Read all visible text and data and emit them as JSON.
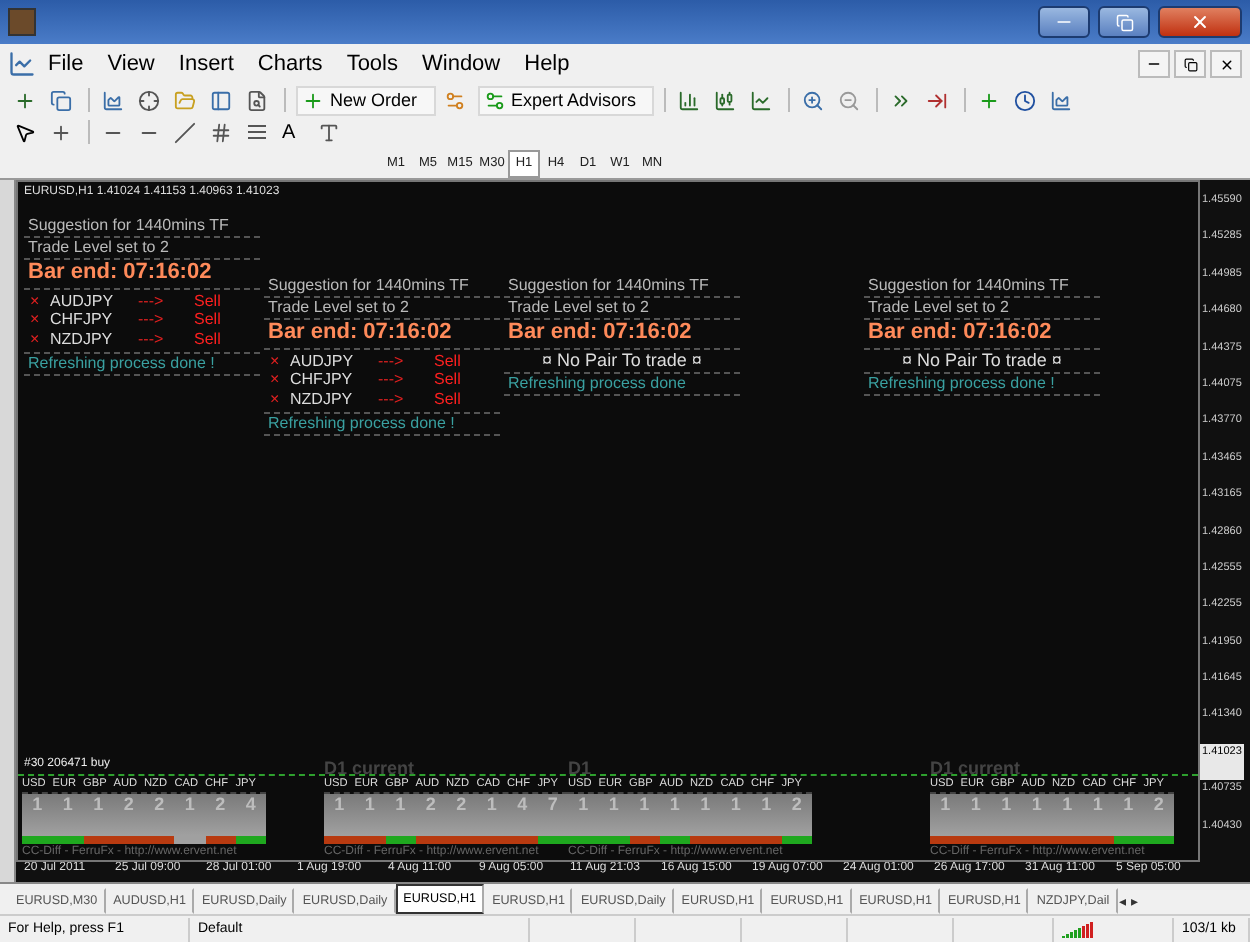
{
  "menu": [
    {
      "label": "File"
    },
    {
      "label": "View"
    },
    {
      "label": "Insert"
    },
    {
      "label": "Charts"
    },
    {
      "label": "Tools"
    },
    {
      "label": "Window"
    },
    {
      "label": "Help"
    }
  ],
  "toolbar": {
    "new_order": "New Order",
    "expert_advisors": "Expert Advisors",
    "text_tool": "A"
  },
  "timeframes": [
    {
      "label": "M1",
      "selected": false
    },
    {
      "label": "M5",
      "selected": false
    },
    {
      "label": "M15",
      "selected": false
    },
    {
      "label": "M30",
      "selected": false
    },
    {
      "label": "H1",
      "selected": true
    },
    {
      "label": "H4",
      "selected": false
    },
    {
      "label": "D1",
      "selected": false
    },
    {
      "label": "W1",
      "selected": false
    },
    {
      "label": "MN",
      "selected": false
    }
  ],
  "chart": {
    "header": "EURUSD,H1  1.41024 1.41153 1.40963 1.41023",
    "panels": [
      {
        "kind": "signals",
        "heading": "Suggestion for 1440mins TF",
        "level": "Trade Level set to 2",
        "bar_end": "Bar end: 07:16:02",
        "signals": [
          {
            "mark": "×",
            "pair": "AUDJPY",
            "arrow": "--->",
            "action": "Sell"
          },
          {
            "mark": "×",
            "pair": "CHFJPY",
            "arrow": "--->",
            "action": "Sell"
          },
          {
            "mark": "×",
            "pair": "NZDJPY",
            "arrow": "--->",
            "action": "Sell"
          }
        ],
        "footer": "Refreshing process done !"
      },
      {
        "kind": "signals",
        "heading": "Suggestion for 1440mins TF",
        "level": "Trade Level set to 2",
        "bar_end": "Bar end: 07:16:02",
        "signals": [
          {
            "mark": "×",
            "pair": "AUDJPY",
            "arrow": "--->",
            "action": "Sell"
          },
          {
            "mark": "×",
            "pair": "CHFJPY",
            "arrow": "--->",
            "action": "Sell"
          },
          {
            "mark": "×",
            "pair": "NZDJPY",
            "arrow": "--->",
            "action": "Sell"
          }
        ],
        "footer": "Refreshing process done !"
      },
      {
        "kind": "no_pair",
        "heading": "Suggestion for 1440mins TF",
        "level": "Trade Level set to 2",
        "bar_end": "Bar end: 07:16:02",
        "message": "¤ No Pair To trade ¤",
        "footer": "Refreshing process done"
      },
      {
        "kind": "no_pair",
        "heading": "Suggestion for 1440mins TF",
        "level": "Trade Level set to 2",
        "bar_end": "Bar end: 07:16:02",
        "message": "¤ No Pair To trade ¤",
        "footer": "Refreshing process done !"
      }
    ],
    "order_label": "#30 206471 buy",
    "strips": [
      {
        "currencies": [
          {
            "code": "USD",
            "value": "1",
            "color": "#1fa81f"
          },
          {
            "code": "EUR",
            "value": "1",
            "color": "#1fa81f"
          },
          {
            "code": "GBP",
            "value": "1",
            "color": "#b83a10"
          },
          {
            "code": "AUD",
            "value": "2",
            "color": "#b83a10"
          },
          {
            "code": "NZD",
            "value": "2",
            "color": "#b83a10"
          },
          {
            "code": "CAD",
            "value": "1",
            "color": "#a0a0a0"
          },
          {
            "code": "CHF",
            "value": "2",
            "color": "#b83a10"
          },
          {
            "code": "JPY",
            "value": "4",
            "color": "#1fa81f"
          }
        ],
        "footer": "CC-Diff - FerruFx - http://www.ervent.net"
      },
      {
        "title": "D1  current",
        "currencies": [
          {
            "code": "USD",
            "value": "1",
            "color": "#b83a10"
          },
          {
            "code": "EUR",
            "value": "1",
            "color": "#b83a10"
          },
          {
            "code": "GBP",
            "value": "1",
            "color": "#1fa81f"
          },
          {
            "code": "AUD",
            "value": "2",
            "color": "#b83a10"
          },
          {
            "code": "NZD",
            "value": "2",
            "color": "#b83a10"
          },
          {
            "code": "CAD",
            "value": "1",
            "color": "#b83a10"
          },
          {
            "code": "CHF",
            "value": "4",
            "color": "#b83a10"
          },
          {
            "code": "JPY",
            "value": "7",
            "color": "#1fa81f"
          }
        ],
        "footer": "CC-Diff - FerruFx - http://www.ervent.net"
      },
      {
        "title": "D1",
        "currencies": [
          {
            "code": "USD",
            "value": "1",
            "color": "#1fa81f"
          },
          {
            "code": "EUR",
            "value": "1",
            "color": "#1fa81f"
          },
          {
            "code": "GBP",
            "value": "1",
            "color": "#b83a10"
          },
          {
            "code": "AUD",
            "value": "1",
            "color": "#1fa81f"
          },
          {
            "code": "NZD",
            "value": "1",
            "color": "#b83a10"
          },
          {
            "code": "CAD",
            "value": "1",
            "color": "#b83a10"
          },
          {
            "code": "CHF",
            "value": "1",
            "color": "#b83a10"
          },
          {
            "code": "JPY",
            "value": "2",
            "color": "#1fa81f"
          }
        ],
        "footer": "CC-Diff - FerruFx - http://www.ervent.net"
      },
      {
        "title": "D1 current",
        "currencies": [
          {
            "code": "USD",
            "value": "1",
            "color": "#b83a10"
          },
          {
            "code": "EUR",
            "value": "1",
            "color": "#b83a10"
          },
          {
            "code": "GBP",
            "value": "1",
            "color": "#b83a10"
          },
          {
            "code": "AUD",
            "value": "1",
            "color": "#b83a10"
          },
          {
            "code": "NZD",
            "value": "1",
            "color": "#b83a10"
          },
          {
            "code": "CAD",
            "value": "1",
            "color": "#b83a10"
          },
          {
            "code": "CHF",
            "value": "1",
            "color": "#1fa81f"
          },
          {
            "code": "JPY",
            "value": "2",
            "color": "#1fa81f"
          }
        ],
        "footer": "CC-Diff - FerruFx - http://www.ervent.net"
      }
    ],
    "price_axis": [
      {
        "label": "1.45590",
        "current": false
      },
      {
        "label": "1.45285",
        "current": false
      },
      {
        "label": "1.44985",
        "current": false
      },
      {
        "label": "1.44680",
        "current": false
      },
      {
        "label": "1.44375",
        "current": false
      },
      {
        "label": "1.44075",
        "current": false
      },
      {
        "label": "1.43770",
        "current": false
      },
      {
        "label": "1.43465",
        "current": false
      },
      {
        "label": "1.43165",
        "current": false
      },
      {
        "label": "1.42860",
        "current": false
      },
      {
        "label": "1.42555",
        "current": false
      },
      {
        "label": "1.42255",
        "current": false
      },
      {
        "label": "1.41950",
        "current": false
      },
      {
        "label": "1.41645",
        "current": false
      },
      {
        "label": "1.41340",
        "current": false
      },
      {
        "label": "1.41023",
        "current": true
      },
      {
        "label": "1.40735",
        "current": false
      },
      {
        "label": "1.40430",
        "current": false
      }
    ],
    "time_axis": [
      "20 Jul 2011",
      "25 Jul 09:00",
      "28 Jul 01:00",
      "1 Aug 19:00",
      "4 Aug 11:00",
      "9 Aug 05:00",
      "11 Aug 21:03",
      "16 Aug 15:00",
      "19 Aug 07:00",
      "24 Aug 01:00",
      "26 Aug 17:00",
      "31 Aug 11:00",
      "5 Sep 05:00"
    ]
  },
  "tabs": [
    {
      "label": "EURUSD,M30",
      "selected": false
    },
    {
      "label": "AUDUSD,H1",
      "selected": false
    },
    {
      "label": "EURUSD,Daily",
      "selected": false
    },
    {
      "label": "EURUSD,Daily",
      "selected": false
    },
    {
      "label": "EURUSD,H1",
      "selected": true
    },
    {
      "label": "EURUSD,H1",
      "selected": false
    },
    {
      "label": "EURUSD,Daily",
      "selected": false
    },
    {
      "label": "EURUSD,H1",
      "selected": false
    },
    {
      "label": "EURUSD,H1",
      "selected": false
    },
    {
      "label": "EURUSD,H1",
      "selected": false
    },
    {
      "label": "EURUSD,H1",
      "selected": false
    },
    {
      "label": "NZDJPY,Dail",
      "selected": false
    }
  ],
  "tab_scroll": [
    "◂",
    "▸"
  ],
  "status_bar": {
    "help": "For Help, press F1",
    "profile": "Default",
    "traffic": "103/1 kb"
  }
}
